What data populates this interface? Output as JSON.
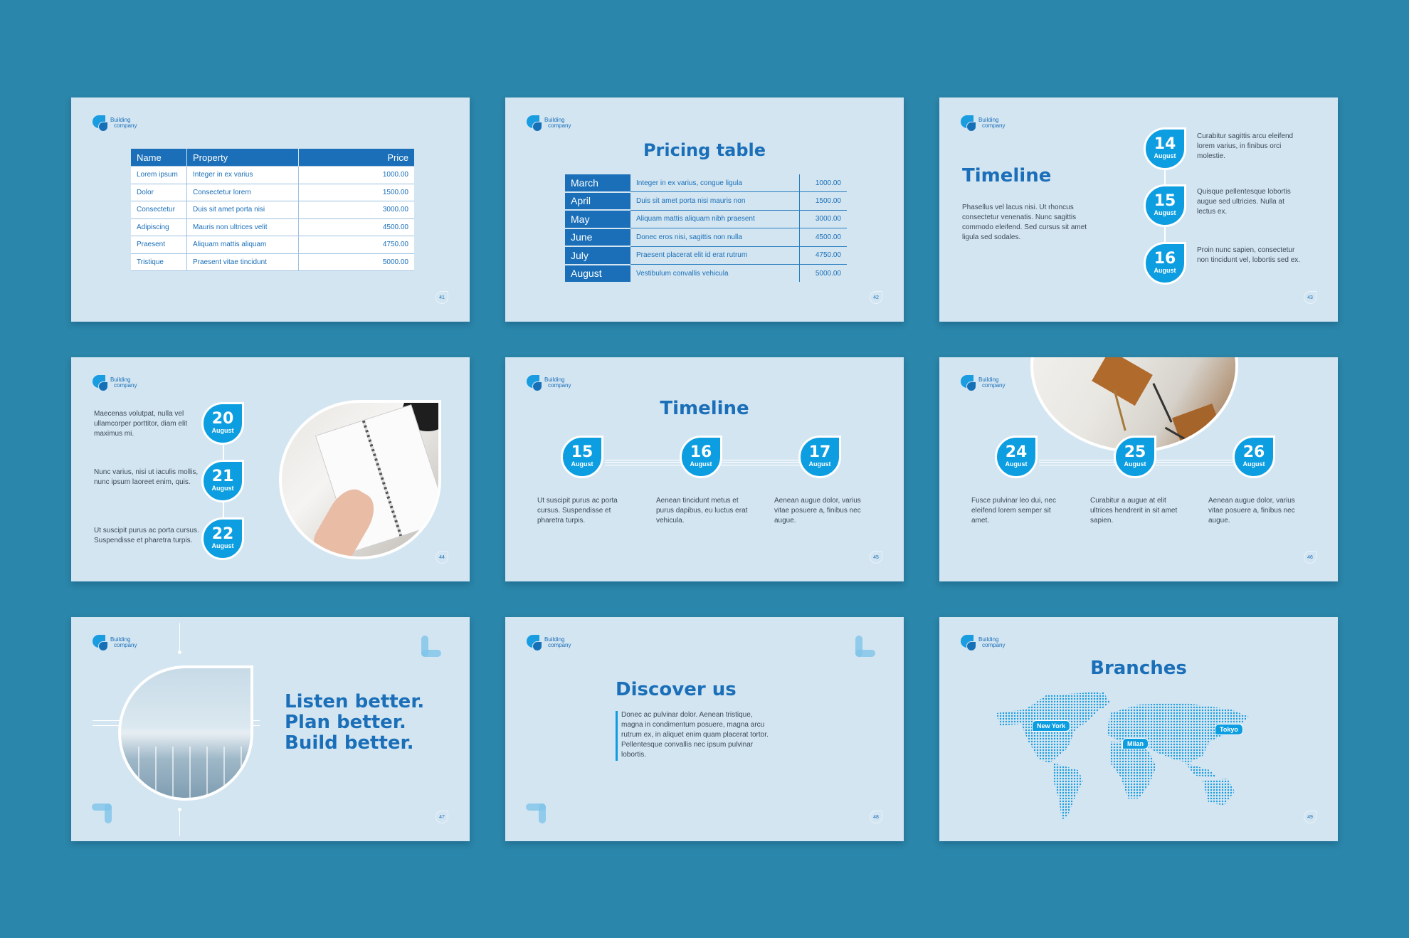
{
  "brand": {
    "line1": "Building",
    "line2": "company"
  },
  "colors": {
    "background": "#2a86aa",
    "slide": "#d3e5f1",
    "primary": "#1a6fb8",
    "accent": "#0c9ee1",
    "text": "#3c4a57"
  },
  "slides": [
    {
      "page": "41",
      "table": {
        "headers": [
          "Name",
          "Property",
          "Price"
        ],
        "rows": [
          [
            "Lorem ipsum",
            "Integer in ex varius",
            "1000.00"
          ],
          [
            "Dolor",
            "Consectetur lorem",
            "1500.00"
          ],
          [
            "Consectetur",
            "Duis sit amet porta nisi",
            "3000.00"
          ],
          [
            "Adipiscing",
            "Mauris non ultrices velit",
            "4500.00"
          ],
          [
            "Praesent",
            "Aliquam mattis aliquam",
            "4750.00"
          ],
          [
            "Tristique",
            "Praesent vitae tincidunt",
            "5000.00"
          ]
        ]
      }
    },
    {
      "page": "42",
      "title": "Pricing table",
      "rows": [
        [
          "March",
          "Integer in ex varius, congue ligula",
          "1000.00"
        ],
        [
          "April",
          "Duis sit amet porta nisi mauris non",
          "1500.00"
        ],
        [
          "May",
          "Aliquam mattis aliquam nibh praesent",
          "3000.00"
        ],
        [
          "June",
          "Donec eros nisi, sagittis non nulla",
          "4500.00"
        ],
        [
          "July",
          "Praesent placerat elit id erat rutrum",
          "4750.00"
        ],
        [
          "August",
          "Vestibulum convallis vehicula",
          "5000.00"
        ]
      ]
    },
    {
      "page": "43",
      "title": "Timeline",
      "intro": "Phasellus vel lacus nisi. Ut rhoncus consectetur venenatis. Nunc sagittis commodo eleifend. Sed cursus sit amet ligula sed sodales.",
      "events": [
        {
          "day": "14",
          "month": "August",
          "text": "Curabitur sagittis arcu eleifend lorem varius, in finibus orci molestie."
        },
        {
          "day": "15",
          "month": "August",
          "text": "Quisque pellentesque lobortis augue sed ultricies. Nulla at lectus ex."
        },
        {
          "day": "16",
          "month": "August",
          "text": "Proin nunc sapien, consectetur non tincidunt vel, lobortis sed ex."
        }
      ]
    },
    {
      "page": "44",
      "events": [
        {
          "day": "20",
          "month": "August",
          "text": "Maecenas volutpat, nulla vel ullamcorper porttitor, diam elit maximus mi."
        },
        {
          "day": "21",
          "month": "August",
          "text": "Nunc varius, nisi ut iaculis mollis, nunc ipsum laoreet enim, quis."
        },
        {
          "day": "22",
          "month": "August",
          "text": "Ut suscipit purus ac porta cursus. Suspendisse et pharetra turpis."
        }
      ]
    },
    {
      "page": "45",
      "title": "Timeline",
      "events": [
        {
          "day": "15",
          "month": "August",
          "text": "Ut suscipit purus ac porta cursus. Suspendisse et pharetra turpis."
        },
        {
          "day": "16",
          "month": "August",
          "text": "Aenean tincidunt metus et purus dapibus, eu luctus erat vehicula."
        },
        {
          "day": "17",
          "month": "August",
          "text": "Aenean augue dolor, varius vitae posuere a, finibus nec augue."
        }
      ]
    },
    {
      "page": "46",
      "events": [
        {
          "day": "24",
          "month": "August",
          "text": "Fusce pulvinar leo dui, nec eleifend lorem semper sit amet."
        },
        {
          "day": "25",
          "month": "August",
          "text": "Curabitur a augue at elit ultrices hendrerit in sit amet sapien."
        },
        {
          "day": "26",
          "month": "August",
          "text": "Aenean augue dolor, varius vitae posuere a, finibus nec augue."
        }
      ]
    },
    {
      "page": "47",
      "lines": [
        "Listen better.",
        "Plan better.",
        "Build better."
      ]
    },
    {
      "page": "48",
      "title": "Discover us",
      "text": "Donec ac pulvinar dolor. Aenean tristique, magna in condimentum posuere, magna arcu rutrum ex, in aliquet enim quam placerat tortor. Pellentesque convallis nec ipsum pulvinar lobortis."
    },
    {
      "page": "49",
      "title": "Branches",
      "pins": [
        "New York",
        "Milan",
        "Tokyo"
      ]
    }
  ]
}
